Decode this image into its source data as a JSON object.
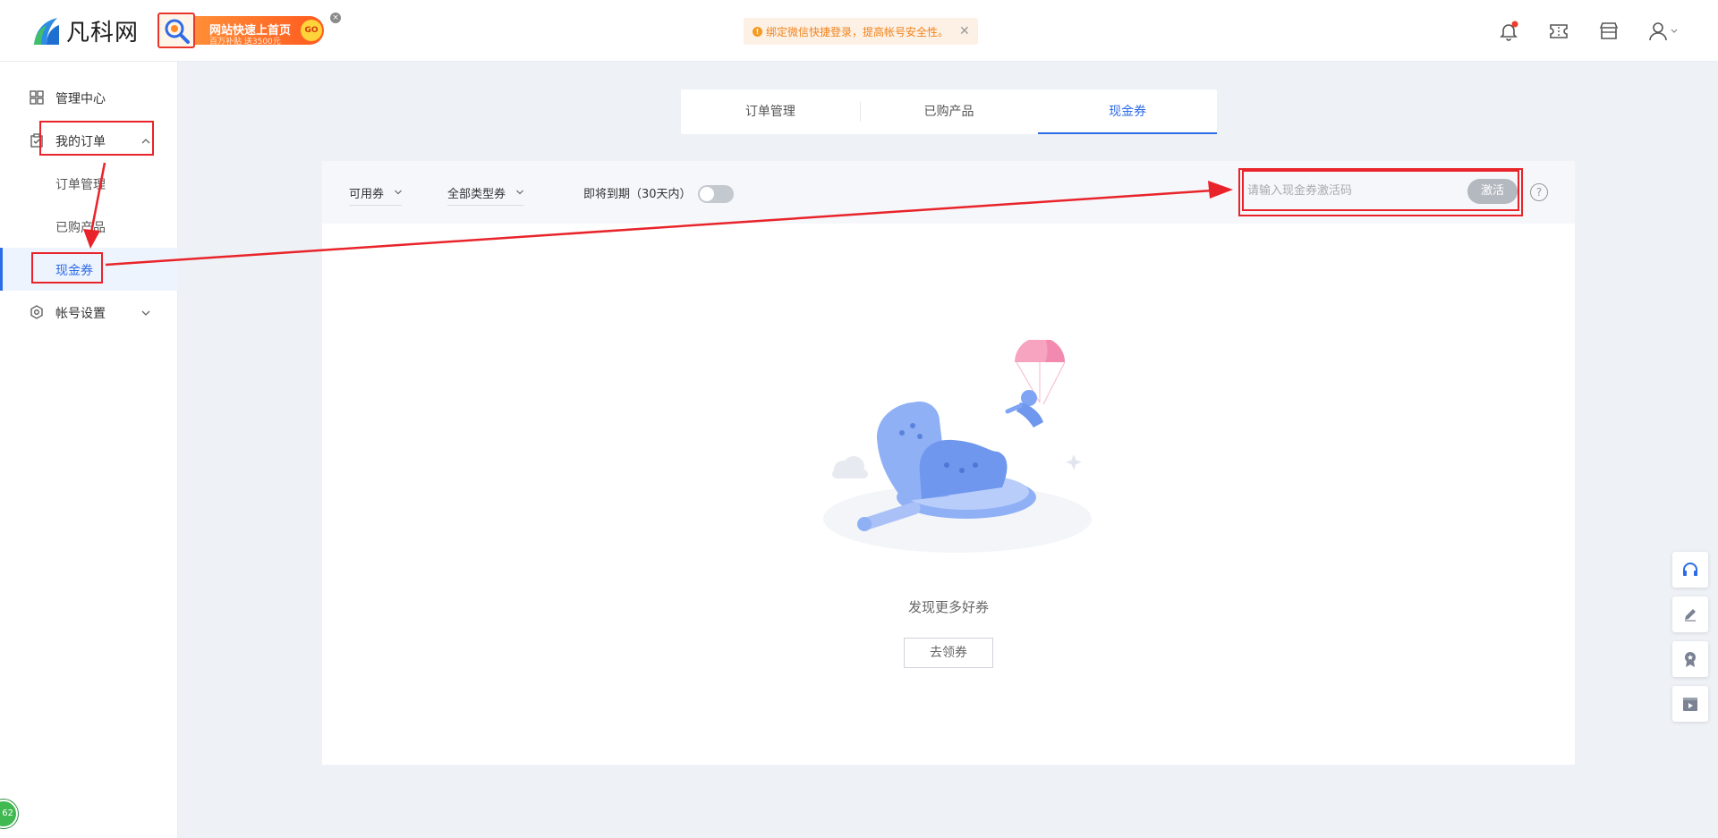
{
  "header": {
    "logo_text": "凡科网",
    "promo": {
      "title": "网站快速上首页",
      "subtitle": "百万补贴 送3500元",
      "go": "GO"
    },
    "notice": {
      "text": "绑定微信快捷登录，提高帐号安全性。"
    },
    "icons": [
      "bell-icon",
      "ticket-icon",
      "store-icon",
      "user-icon"
    ],
    "accent": "#2e6be6"
  },
  "sidebar": {
    "items": [
      {
        "label": "管理中心",
        "icon": "grid-icon"
      },
      {
        "label": "我的订单",
        "icon": "clipboard-icon"
      },
      {
        "label": "订单管理"
      },
      {
        "label": "已购产品"
      },
      {
        "label": "现金券"
      },
      {
        "label": "帐号设置",
        "icon": "settings-icon"
      }
    ]
  },
  "tabs": [
    {
      "label": "订单管理"
    },
    {
      "label": "已购产品"
    },
    {
      "label": "现金券"
    }
  ],
  "filters": {
    "availability": "可用券",
    "type": "全部类型券",
    "expiring_label": "即将到期（30天内）"
  },
  "coupon_code": {
    "placeholder": "请输入现金券激活码",
    "value": "",
    "activate_label": "激活",
    "help": "?"
  },
  "empty_state": {
    "message": "发现更多好券",
    "button_label": "去领券"
  },
  "floating_tools": [
    "headset-icon",
    "edit-icon",
    "award-icon",
    "video-icon"
  ],
  "badge_number": "62",
  "annotation_color": "#e8242a"
}
